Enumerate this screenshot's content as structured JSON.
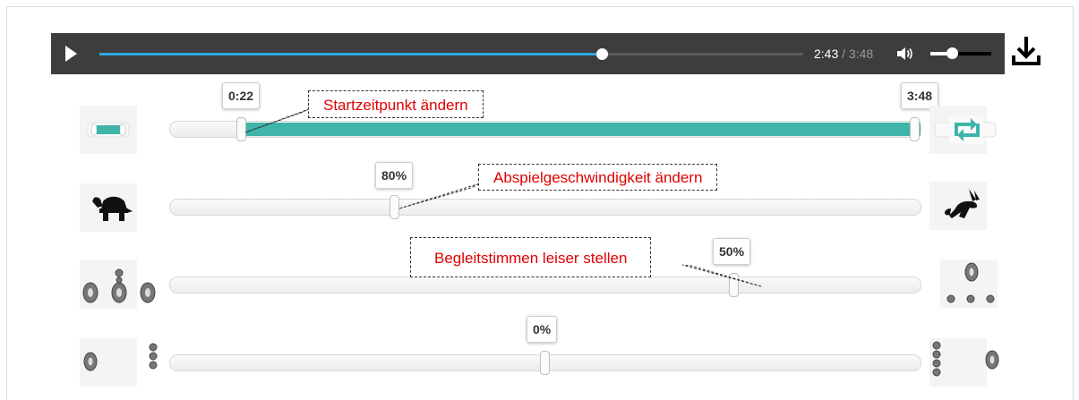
{
  "player": {
    "current_time": "2:43",
    "separator": " / ",
    "duration": "3:48",
    "progress": 0.714,
    "volume": 0.35,
    "colors": {
      "bar_bg": "#3d3d3d",
      "progress": "#2ea9e2"
    },
    "icons": [
      "play-icon",
      "volume-icon",
      "download-icon"
    ]
  },
  "range": {
    "start_label": "0:22",
    "end_label": "3:48",
    "start_fraction": 0.096,
    "end_fraction": 1.0,
    "color": "#3fb5aa",
    "icons": [
      "segment-icon",
      "loop-icon"
    ]
  },
  "speed": {
    "label": "80%",
    "value": 0.3,
    "icons": [
      "turtle-icon",
      "rabbit-icon"
    ]
  },
  "accompaniment": {
    "label": "50%",
    "value": 0.752,
    "icons": [
      "speakers-loud-icon",
      "speakers-quiet-icon"
    ]
  },
  "balance": {
    "label": "0%",
    "value": 0.5,
    "icons": [
      "balance-left-icon",
      "balance-right-icon"
    ]
  },
  "callouts": {
    "start": "Startzeitpunkt ändern",
    "speed": "Abspielgeschwindigkeit ändern",
    "accompaniment": "Begleitstimmen leiser stellen",
    "color": "#e00000"
  }
}
